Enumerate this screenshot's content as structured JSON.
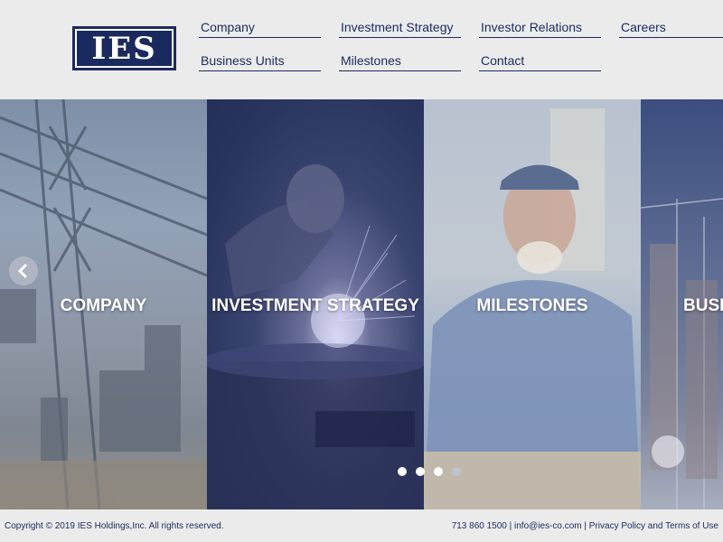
{
  "logo": {
    "text": "IES"
  },
  "nav": {
    "row1": [
      "Company",
      "Investment Strategy",
      "Investor Relations",
      "Careers"
    ],
    "row2": [
      "Business Units",
      "Milestones",
      "Contact"
    ]
  },
  "hero": {
    "panels": [
      "COMPANY",
      "INVESTMENT STRATEGY",
      "MILESTONES",
      "BUSINESS UNITS"
    ],
    "slide_count": 4,
    "active_slide": 3
  },
  "footer": {
    "copyright": "Copyright © 2019 IES Holdings,Inc. All rights reserved.",
    "phone": "713 860 1500",
    "separator": " | ",
    "email": "info@ies-co.com",
    "policy": "Privacy Policy and Terms of Use"
  },
  "colors": {
    "brand": "#1b2a5e",
    "background": "#ebebeb"
  },
  "icons": {
    "prev": "chevron-left-icon"
  }
}
